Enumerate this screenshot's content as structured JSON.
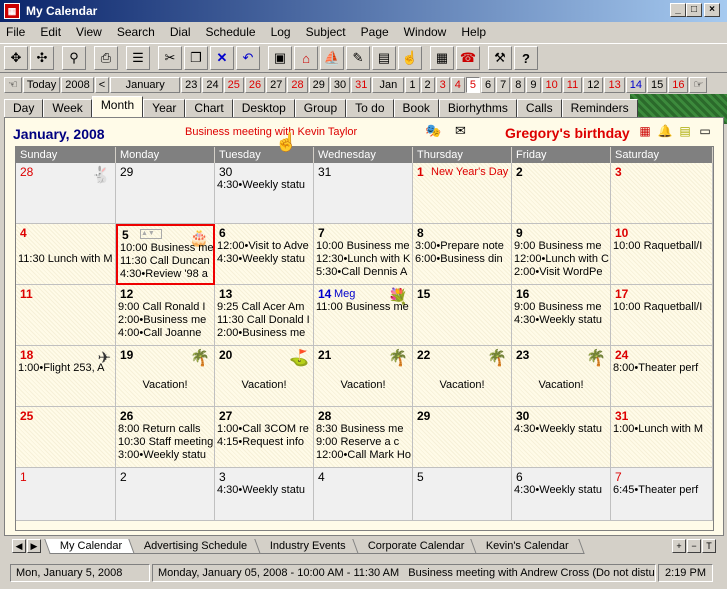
{
  "window": {
    "title": "My Calendar"
  },
  "menu": [
    "File",
    "Edit",
    "View",
    "Search",
    "Dial",
    "Schedule",
    "Log",
    "Subject",
    "Page",
    "Window",
    "Help"
  ],
  "datestrip": {
    "today": "Today",
    "year": "2008",
    "month": "January",
    "days_prev": [
      "23",
      "24",
      "25",
      "26",
      "27",
      "28",
      "29",
      "30",
      "31"
    ],
    "next_month": "Jan",
    "days_next": [
      "1",
      "2",
      "3",
      "4",
      "5",
      "6",
      "7",
      "8",
      "9",
      "10",
      "11",
      "12",
      "13",
      "14",
      "15",
      "16"
    ]
  },
  "view_tabs": [
    "Day",
    "Week",
    "Month",
    "Year",
    "Chart",
    "Desktop",
    "Group",
    "To do",
    "Book",
    "Biorhythms",
    "Calls",
    "Reminders"
  ],
  "active_view": "Month",
  "month_title": "January, 2008",
  "banner": "Business meeting with Kevin Taylor",
  "birthday": "Gregory's birthday",
  "weekdays": [
    "Sunday",
    "Monday",
    "Tuesday",
    "Wednesday",
    "Thursday",
    "Friday",
    "Saturday"
  ],
  "weeks": [
    [
      {
        "d": "28",
        "s": "lightred",
        "o": true,
        "icon": "rabbit-icon"
      },
      {
        "d": "29",
        "s": "light",
        "o": true
      },
      {
        "d": "30",
        "s": "light",
        "o": true,
        "ev": [
          "4:30•Weekly statu"
        ]
      },
      {
        "d": "31",
        "s": "light",
        "o": true
      },
      {
        "d": "1",
        "s": "red",
        "note": "New Year's Day"
      },
      {
        "d": "2"
      },
      {
        "d": "3",
        "s": "red"
      }
    ],
    [
      {
        "d": "4",
        "s": "red",
        "ev": [
          "",
          "11:30  Lunch with M"
        ]
      },
      {
        "d": "5",
        "today": true,
        "icon": "cake-icon",
        "ev": [
          "10:00  Business me",
          "11:30  Call Duncan",
          "4:30•Review '98 a"
        ]
      },
      {
        "d": "6",
        "ev": [
          "12:00•Visit to Adve",
          "4:30•Weekly statu"
        ]
      },
      {
        "d": "7",
        "ev": [
          "10:00  Business me",
          "12:30•Lunch with K",
          "5:30•Call Dennis A"
        ]
      },
      {
        "d": "8",
        "ev": [
          "3:00•Prepare note",
          "6:00•Business din"
        ]
      },
      {
        "d": "9",
        "ev": [
          "9:00  Business me",
          "12:00•Lunch with C",
          "2:00•Visit WordPe"
        ]
      },
      {
        "d": "10",
        "s": "red",
        "ev": [
          "10:00  Raquetball/I"
        ]
      }
    ],
    [
      {
        "d": "11",
        "s": "red"
      },
      {
        "d": "12",
        "ev": [
          "9:00  Call Ronald I",
          "2:00•Business me",
          "4:00•Call Joanne"
        ]
      },
      {
        "d": "13",
        "ev": [
          "9:25  Call Acer Am",
          "11:30  Call Donald I",
          "2:00•Business me"
        ]
      },
      {
        "d": "14",
        "s": "blue",
        "note": "Meg",
        "icon": "flowers-icon",
        "ev": [
          "11:00  Business me"
        ]
      },
      {
        "d": "15"
      },
      {
        "d": "16",
        "ev": [
          "9:00  Business me",
          "4:30•Weekly statu"
        ]
      },
      {
        "d": "17",
        "s": "red",
        "ev": [
          "10:00  Raquetball/I"
        ]
      }
    ],
    [
      {
        "d": "18",
        "s": "red",
        "icon": "plane-icon",
        "ev": [
          "1:00•Flight 253, A"
        ]
      },
      {
        "d": "19",
        "icon": "palm-icon",
        "vac": "Vacation!"
      },
      {
        "d": "20",
        "icon": "golf-icon",
        "vac": "Vacation!"
      },
      {
        "d": "21",
        "icon": "palm-icon",
        "vac": "Vacation!"
      },
      {
        "d": "22",
        "icon": "palm-icon",
        "vac": "Vacation!"
      },
      {
        "d": "23",
        "icon": "palm-icon",
        "vac": "Vacation!"
      },
      {
        "d": "24",
        "s": "red",
        "ev": [
          "8:00•Theater perf"
        ]
      }
    ],
    [
      {
        "d": "25",
        "s": "red"
      },
      {
        "d": "26",
        "ev": [
          "8:00  Return calls",
          "10:30  Staff meeting",
          "3:00•Weekly statu"
        ]
      },
      {
        "d": "27",
        "ev": [
          "1:00•Call 3COM re",
          "4:15•Request info"
        ]
      },
      {
        "d": "28",
        "ev": [
          "8:30  Business me",
          "9:00  Reserve a c",
          "12:00•Call Mark Ho"
        ]
      },
      {
        "d": "29"
      },
      {
        "d": "30",
        "ev": [
          "4:30•Weekly statu"
        ]
      },
      {
        "d": "31",
        "s": "red",
        "ev": [
          "1:00•Lunch with M"
        ]
      }
    ],
    [
      {
        "d": "1",
        "s": "lightred",
        "o": true
      },
      {
        "d": "2",
        "s": "light",
        "o": true
      },
      {
        "d": "3",
        "s": "light",
        "o": true,
        "ev": [
          "4:30•Weekly statu"
        ]
      },
      {
        "d": "4",
        "s": "light",
        "o": true
      },
      {
        "d": "5",
        "s": "light",
        "o": true
      },
      {
        "d": "6",
        "s": "light",
        "o": true,
        "ev": [
          "4:30•Weekly statu"
        ]
      },
      {
        "d": "7",
        "s": "lightred",
        "o": true,
        "ev": [
          "6:45•Theater perf"
        ]
      }
    ]
  ],
  "bottom_tabs": [
    "My Calendar",
    "Advertising Schedule",
    "Industry Events",
    "Corporate Calendar",
    "Kevin's Calendar"
  ],
  "active_bottom_tab": "My Calendar",
  "status": {
    "date": "Mon, January 5, 2008",
    "detail": "Monday, January 05, 2008 - 10:00 AM - 11:30 AM",
    "subject": "Business meeting with Andrew Cross (Do not disturb)",
    "time": "2:19 PM"
  }
}
